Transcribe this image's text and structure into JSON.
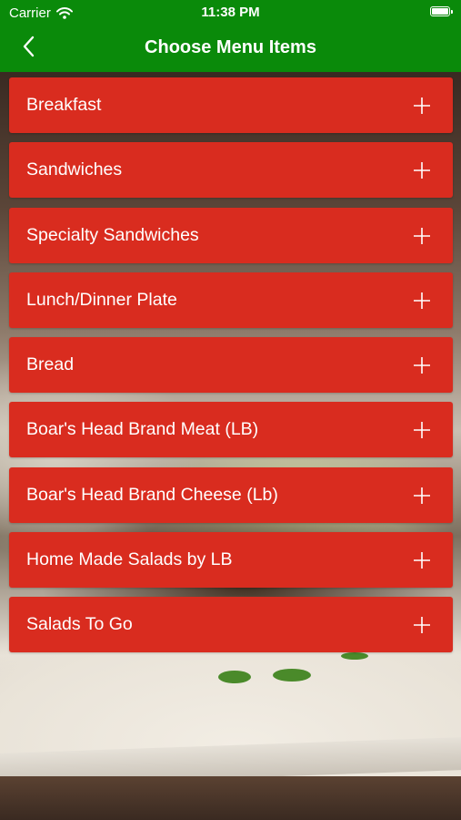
{
  "status_bar": {
    "carrier": "Carrier",
    "time": "11:38 PM",
    "wifi_icon": "wifi-icon",
    "battery_icon": "battery-icon"
  },
  "nav": {
    "title": "Choose Menu Items",
    "back_icon": "chevron-left-icon"
  },
  "colors": {
    "nav_green": "#0a8a0a",
    "item_red": "#d92c1f",
    "text": "#ffffff"
  },
  "menu": {
    "items": [
      {
        "label": "Breakfast",
        "icon": "plus-icon"
      },
      {
        "label": "Sandwiches",
        "icon": "plus-icon"
      },
      {
        "label": "Specialty Sandwiches",
        "icon": "plus-icon"
      },
      {
        "label": "Lunch/Dinner Plate",
        "icon": "plus-icon"
      },
      {
        "label": "Bread",
        "icon": "plus-icon"
      },
      {
        "label": "Boar's Head Brand Meat (LB)",
        "icon": "plus-icon"
      },
      {
        "label": "Boar's Head Brand Cheese (Lb)",
        "icon": "plus-icon"
      },
      {
        "label": "Home Made Salads by LB",
        "icon": "plus-icon"
      },
      {
        "label": "Salads To Go",
        "icon": "plus-icon"
      }
    ]
  }
}
